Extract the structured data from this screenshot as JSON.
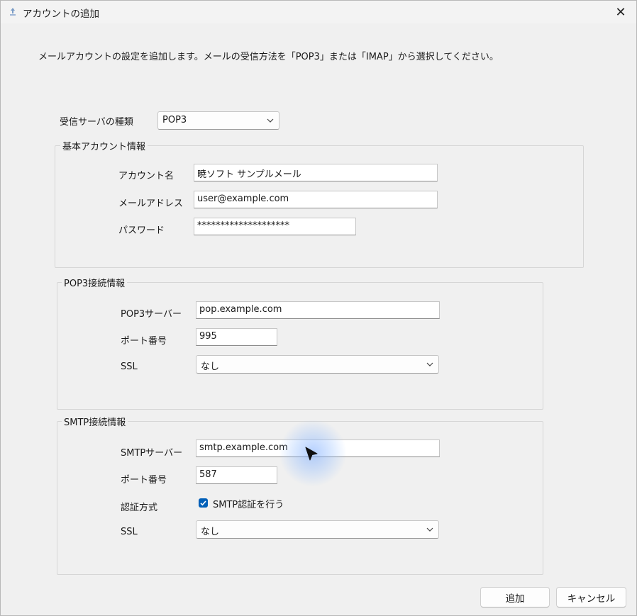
{
  "window": {
    "title": "アカウントの追加",
    "close_label": "✕"
  },
  "description": "メールアカウントの設定を追加します。メールの受信方法を「POP3」または「IMAP」から選択してください。",
  "server_type": {
    "label": "受信サーバの種類",
    "value": "POP3"
  },
  "basic": {
    "legend": "基本アカウント情報",
    "account_name_label": "アカウント名",
    "account_name_value": "暁ソフト サンプルメール",
    "email_label": "メールアドレス",
    "email_value": "user@example.com",
    "password_label": "パスワード",
    "password_value": "********************"
  },
  "pop3": {
    "legend": "POP3接続情報",
    "server_label": "POP3サーバー",
    "server_value": "pop.example.com",
    "port_label": "ポート番号",
    "port_value": "995",
    "ssl_label": "SSL",
    "ssl_value": "なし"
  },
  "smtp": {
    "legend": "SMTP接続情報",
    "server_label": "SMTPサーバー",
    "server_value": "smtp.example.com",
    "port_label": "ポート番号",
    "port_value": "587",
    "auth_label": "認証方式",
    "auth_checkbox_label": "SMTP認証を行う",
    "auth_checked": true,
    "ssl_label": "SSL",
    "ssl_value": "なし"
  },
  "buttons": {
    "add": "追加",
    "cancel": "キャンセル"
  },
  "colors": {
    "accent": "#005fb8",
    "window_bg": "#f0f0f0"
  }
}
